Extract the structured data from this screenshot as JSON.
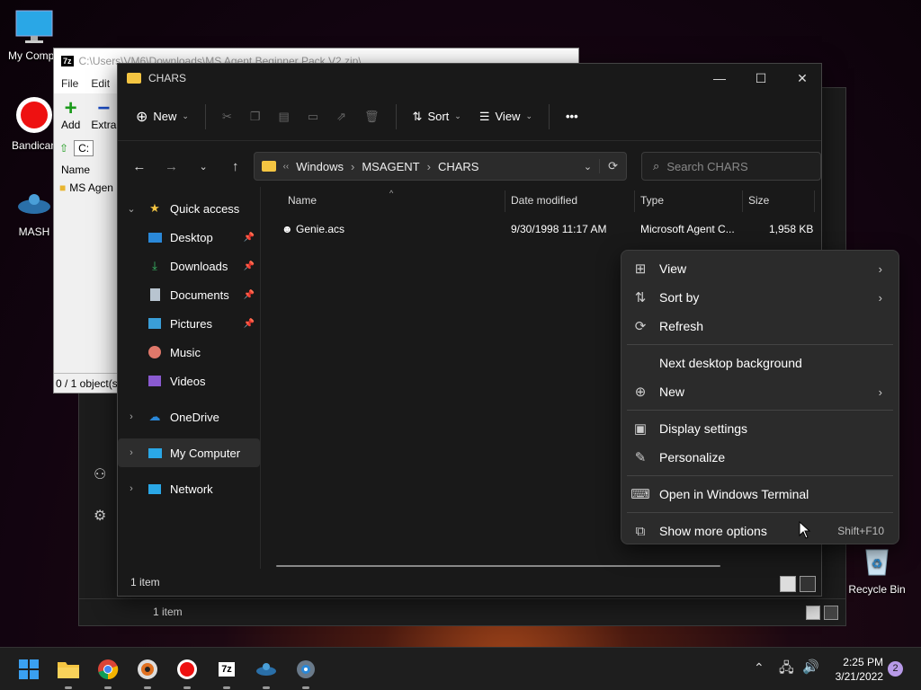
{
  "desktop": {
    "icons": [
      {
        "label": "My Compu",
        "icon": "monitor-icon"
      },
      {
        "label": "Bandican",
        "icon": "record-icon"
      },
      {
        "label": "MASH",
        "icon": "genie-icon"
      },
      {
        "label": "Recycle Bin",
        "icon": "recycle-bin-icon"
      }
    ]
  },
  "zip_window": {
    "title": "C:\\Users\\VM6\\Downloads\\MS Agent Beginner Pack V2.zip\\",
    "menu": [
      "File",
      "Edit"
    ],
    "toolbar": {
      "add": "Add",
      "extract": "Extra"
    },
    "path": "C:",
    "column_name": "Name",
    "item": "MS Agen",
    "status": "0 / 1 object(s"
  },
  "back_window": {
    "status": "1 item"
  },
  "explorer": {
    "title": "CHARS",
    "toolbar": {
      "new": "New",
      "sort": "Sort",
      "view": "View",
      "more": "•••"
    },
    "breadcrumb": [
      "Windows",
      "MSAGENT",
      "CHARS"
    ],
    "search_placeholder": "Search CHARS",
    "sidebar": {
      "quick_access": "Quick access",
      "pinned": [
        "Desktop",
        "Downloads",
        "Documents",
        "Pictures"
      ],
      "other": [
        "Music",
        "Videos"
      ],
      "onedrive": "OneDrive",
      "my_computer": "My Computer",
      "network": "Network"
    },
    "columns": {
      "name": "Name",
      "date": "Date modified",
      "type": "Type",
      "size": "Size"
    },
    "files": [
      {
        "name": "Genie.acs",
        "date": "9/30/1998 11:17 AM",
        "type": "Microsoft Agent C...",
        "size": "1,958 KB"
      }
    ],
    "status": "1 item"
  },
  "context_menu": {
    "items": [
      {
        "label": "View",
        "icon": "grid-icon",
        "submenu": true
      },
      {
        "label": "Sort by",
        "icon": "sort-icon",
        "submenu": true
      },
      {
        "label": "Refresh",
        "icon": "refresh-icon",
        "submenu": false
      },
      {
        "label": "Next desktop background",
        "icon": "",
        "submenu": false
      },
      {
        "label": "New",
        "icon": "plus-circle-icon",
        "submenu": true
      },
      {
        "label": "Display settings",
        "icon": "display-icon",
        "submenu": false
      },
      {
        "label": "Personalize",
        "icon": "brush-icon",
        "submenu": false
      },
      {
        "label": "Open in Windows Terminal",
        "icon": "terminal-icon",
        "submenu": false
      },
      {
        "label": "Show more options",
        "icon": "share-icon",
        "shortcut": "Shift+F10"
      }
    ]
  },
  "taskbar": {
    "time": "2:25 PM",
    "date": "3/21/2022",
    "notifications": "2",
    "apps": [
      "windows-start-icon",
      "file-explorer-icon",
      "chrome-icon",
      "media-player-icon",
      "bandicam-icon",
      "7zip-icon",
      "genie-icon",
      "settings-icon"
    ]
  },
  "colors": {
    "accent": "#0078d4",
    "folder": "#f4c542",
    "menu_bg": "#2b2b2b",
    "explorer_bg": "#191919"
  }
}
